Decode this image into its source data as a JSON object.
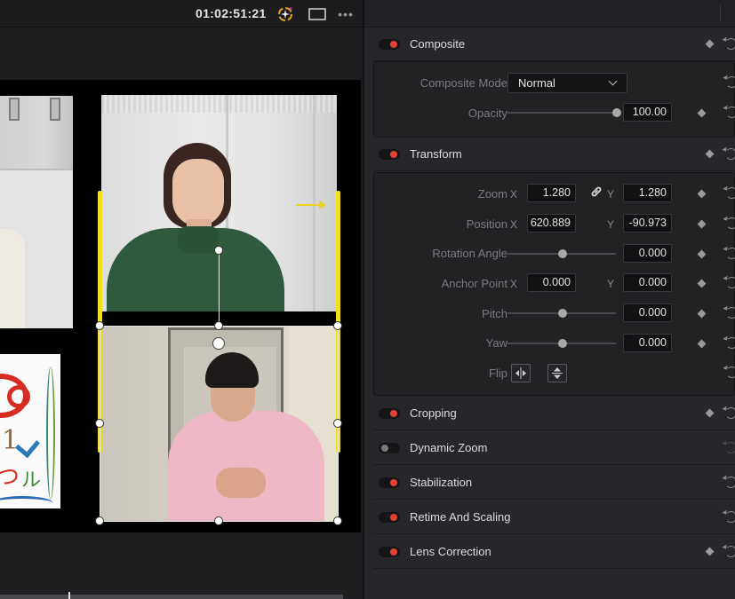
{
  "viewer": {
    "timecode": "01:02:51:21",
    "toolbar": {
      "fx_icon": "magic-wand-icon",
      "screen_icon": "viewer-size-icon",
      "more_icon": "more-options-icon",
      "more_glyph": "•••"
    },
    "left_bottom_clip_glyphs": [
      "1",
      "つ",
      "ル"
    ]
  },
  "inspector": {
    "composite": {
      "title": "Composite",
      "enabled": true,
      "mode_label": "Composite Mode",
      "mode_value": "Normal",
      "opacity_label": "Opacity",
      "opacity_value": "100.00"
    },
    "transform": {
      "title": "Transform",
      "enabled": true,
      "zoom": {
        "label": "Zoom",
        "x_axis": "X",
        "y_axis": "Y",
        "x": "1.280",
        "y": "1.280"
      },
      "position": {
        "label": "Position",
        "x_axis": "X",
        "y_axis": "Y",
        "x": "620.889",
        "y": "-90.973"
      },
      "rotation": {
        "label": "Rotation Angle",
        "value": "0.000"
      },
      "anchor": {
        "label": "Anchor Point",
        "x_axis": "X",
        "y_axis": "Y",
        "x": "0.000",
        "y": "0.000"
      },
      "pitch": {
        "label": "Pitch",
        "value": "0.000"
      },
      "yaw": {
        "label": "Yaw",
        "value": "0.000"
      },
      "flip": {
        "label": "Flip"
      }
    },
    "sections": [
      {
        "title": "Cropping",
        "enabled": true
      },
      {
        "title": "Dynamic Zoom",
        "enabled": false
      },
      {
        "title": "Stabilization",
        "enabled": true
      },
      {
        "title": "Retime And Scaling",
        "enabled": true
      },
      {
        "title": "Lens Correction",
        "enabled": true
      }
    ],
    "colors": {
      "toggle_on": "#e5402f",
      "toggle_off": "#7a7a7a",
      "selection_edge": "#f3e01c",
      "fx_ring": "#e8a41c"
    }
  }
}
